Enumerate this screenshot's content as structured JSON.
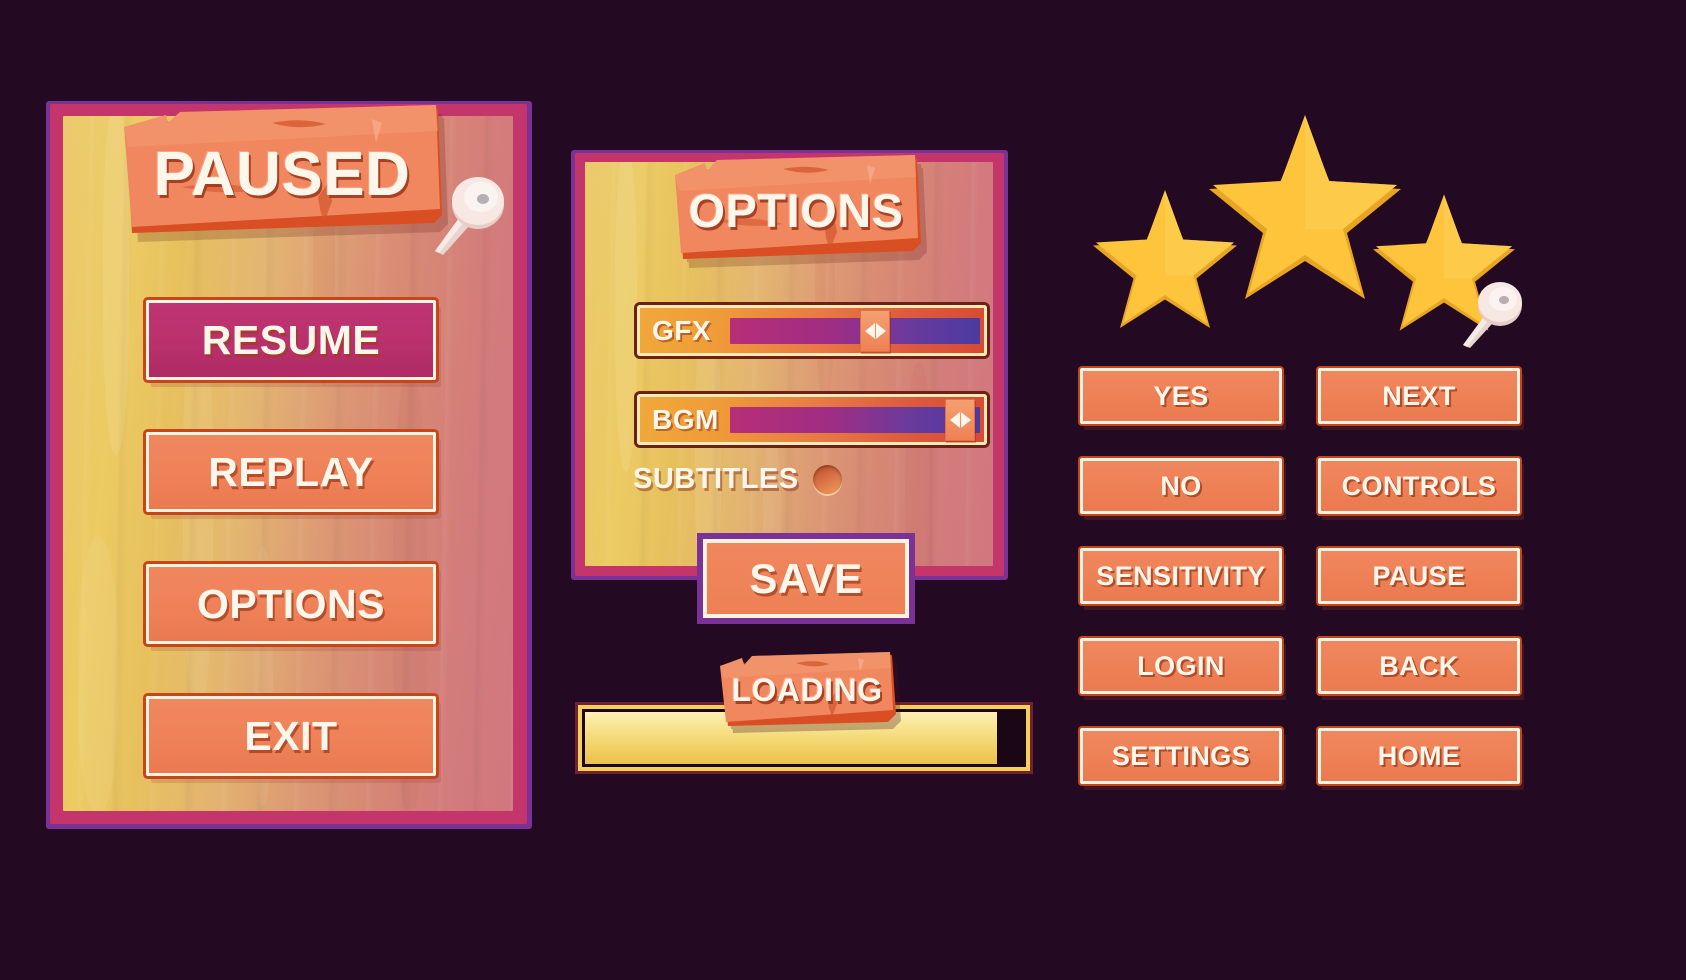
{
  "theme": {
    "background": "#230a22",
    "panel_frame_purple": "#7b3296",
    "panel_frame_magenta": "#c4356b",
    "button_orange": "#ef8158",
    "button_magenta": "#bf3573",
    "text_cream": "#fdf6ea",
    "star_gold": "#fdc43c",
    "slider_track": "#a02d84",
    "loading_fill": "#f2d46a"
  },
  "paused_panel": {
    "title": "PAUSED",
    "pin_icon": "pushpin-icon",
    "buttons": [
      {
        "id": "resume",
        "label": "RESUME",
        "style": "magenta"
      },
      {
        "id": "replay",
        "label": "REPLAY",
        "style": "orange"
      },
      {
        "id": "options",
        "label": "OPTIONS",
        "style": "orange"
      },
      {
        "id": "exit",
        "label": "EXIT",
        "style": "orange"
      }
    ]
  },
  "options_panel": {
    "title": "OPTIONS",
    "pin_icon": "pushpin-icon",
    "sliders": [
      {
        "id": "gfx",
        "label": "GFX",
        "value": 58,
        "min": 0,
        "max": 100,
        "thumb_icon": "left-right-arrows-icon"
      },
      {
        "id": "bgm",
        "label": "BGM",
        "value": 92,
        "min": 0,
        "max": 100,
        "thumb_icon": "left-right-arrows-icon"
      }
    ],
    "subtitles": {
      "label": "SUBTITLES",
      "state": "off",
      "toggle_icon": "circle-toggle-icon"
    },
    "save_label": "SAVE"
  },
  "loading": {
    "label": "LOADING",
    "progress": 94,
    "progress_unit": "%"
  },
  "stars": {
    "icon": "star-icon",
    "count": 3,
    "filled": 3,
    "sizes": [
      "small",
      "large",
      "small"
    ]
  },
  "button_grid": {
    "columns": 2,
    "items": [
      {
        "id": "yes",
        "label": "YES",
        "col": 1,
        "row": 1
      },
      {
        "id": "next",
        "label": "NEXT",
        "col": 2,
        "row": 1
      },
      {
        "id": "no",
        "label": "NO",
        "col": 1,
        "row": 2
      },
      {
        "id": "controls",
        "label": "CONTROLS",
        "col": 2,
        "row": 2
      },
      {
        "id": "sensitivity",
        "label": "SENSITIVITY",
        "col": 1,
        "row": 3
      },
      {
        "id": "pause",
        "label": "PAUSE",
        "col": 2,
        "row": 3
      },
      {
        "id": "login",
        "label": "LOGIN",
        "col": 1,
        "row": 4
      },
      {
        "id": "back",
        "label": "BACK",
        "col": 2,
        "row": 4
      },
      {
        "id": "settings",
        "label": "SETTINGS",
        "col": 1,
        "row": 5
      },
      {
        "id": "home",
        "label": "HOME",
        "col": 2,
        "row": 5
      }
    ]
  }
}
